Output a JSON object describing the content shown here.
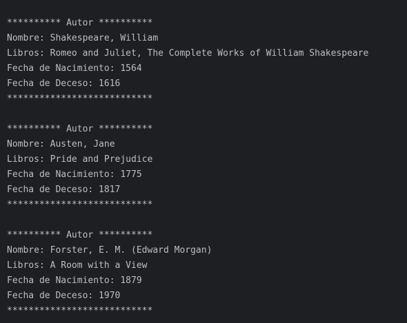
{
  "colors": {
    "background": "#1e1f22",
    "text": "#bcbec4"
  },
  "output": {
    "header_line": "********** Autor **********",
    "footer_line": "***************************",
    "authors": [
      {
        "name_line": "Nombre: Shakespeare, William",
        "books_line": "Libros: Romeo and Juliet, The Complete Works of William Shakespeare",
        "birth_line": "Fecha de Nacimiento: 1564",
        "death_line": "Fecha de Deceso: 1616"
      },
      {
        "name_line": "Nombre: Austen, Jane",
        "books_line": "Libros: Pride and Prejudice",
        "birth_line": "Fecha de Nacimiento: 1775",
        "death_line": "Fecha de Deceso: 1817"
      },
      {
        "name_line": "Nombre: Forster, E. M. (Edward Morgan)",
        "books_line": "Libros: A Room with a View",
        "birth_line": "Fecha de Nacimiento: 1879",
        "death_line": "Fecha de Deceso: 1970"
      }
    ]
  }
}
